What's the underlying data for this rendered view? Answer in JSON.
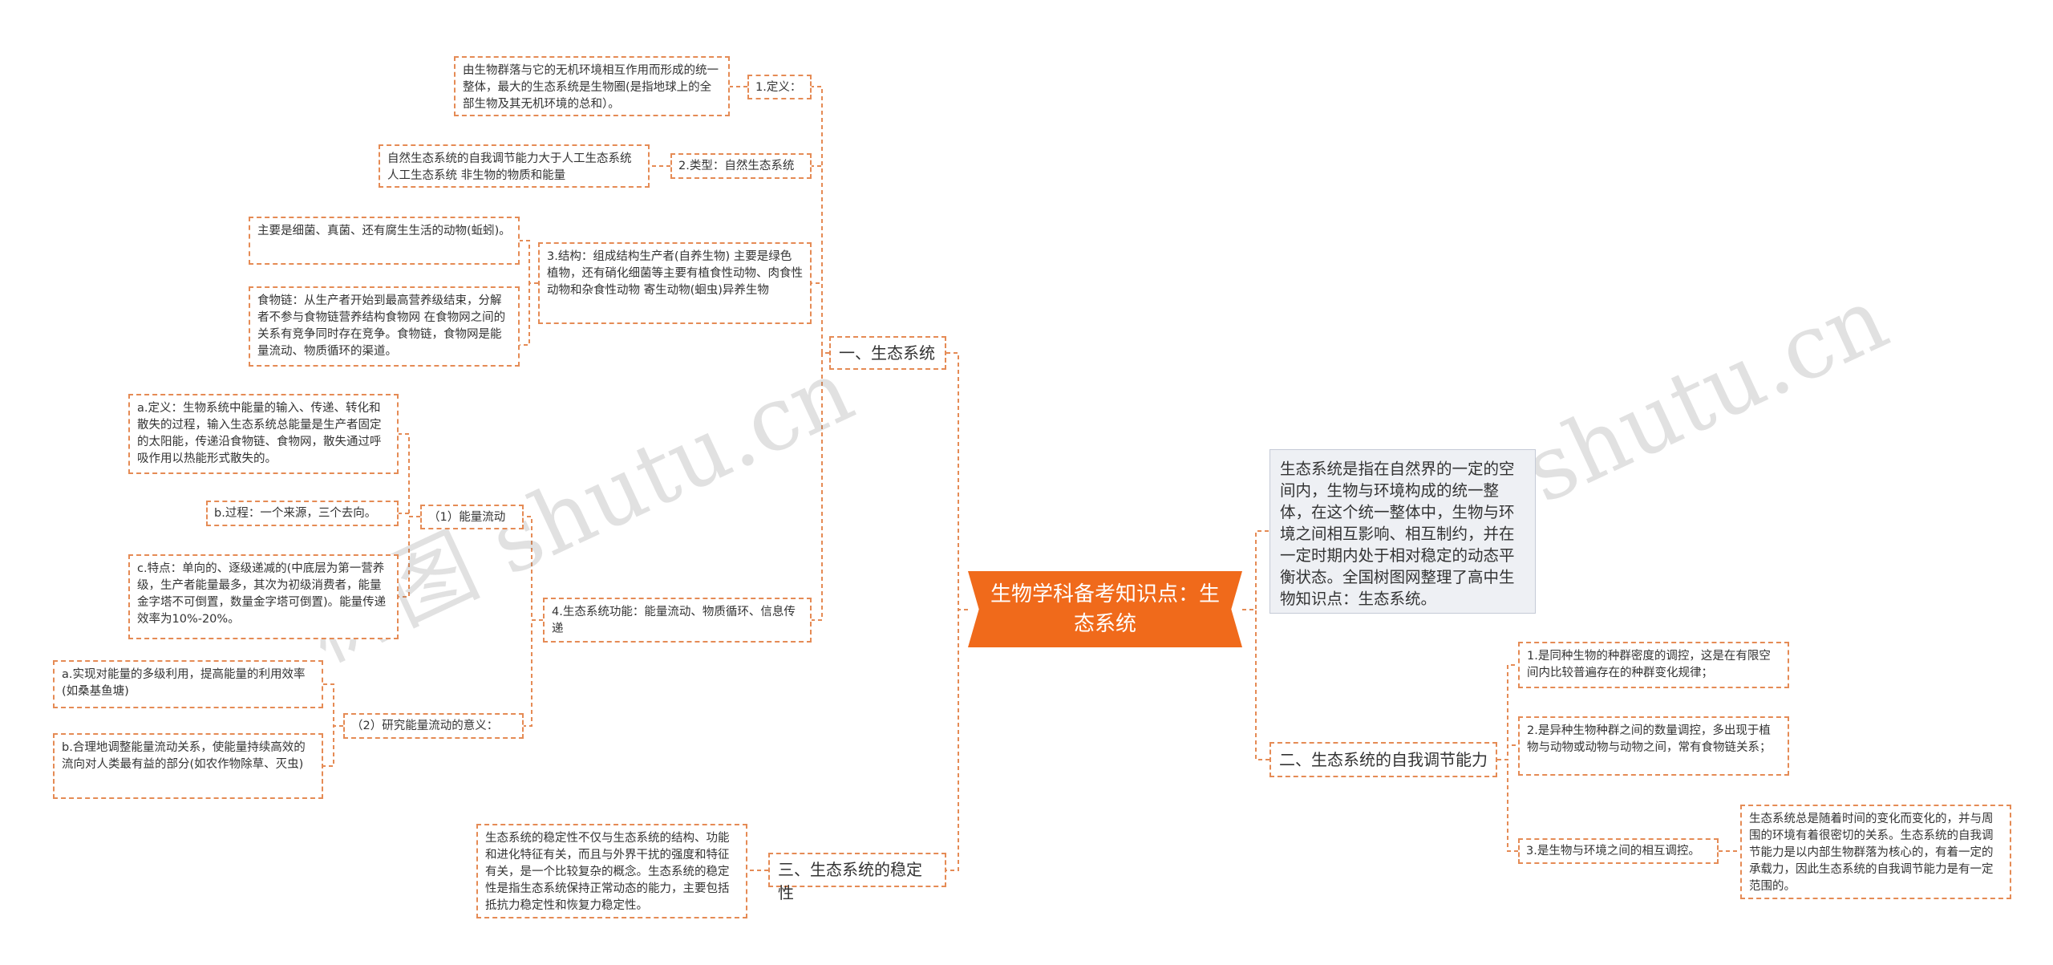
{
  "root": "生物学科备考知识点：生态系统",
  "summary": "生态系统是指在自然界的一定的空间内，生物与环境构成的统一整体，在这个统一整体中，生物与环境之间相互影响、相互制约，并在一定时期内处于相对稳定的动态平衡状态。全国树图网整理了高中生物知识点：生态系统。",
  "watermarks": [
    "树图 shutu.cn",
    "树图 shutu.cn"
  ],
  "left": {
    "b1": {
      "label": "一、生态系统",
      "def_label": "1.定义：",
      "def_text": "由生物群落与它的无机环境相互作用而形成的统一整体，最大的生态系统是生物圈(是指地球上的全部生物及其无机环境的总和）。",
      "type_label": "2.类型：自然生态系统",
      "type_text": "自然生态系统的自我调节能力大于人工生态系统 人工生态系统 非生物的物质和能量",
      "struct_label": "3.结构：组成结构生产者(自养生物) 主要是绿色植物，还有硝化细菌等主要有植食性动物、肉食性动物和杂食性动物 寄生动物(蛔虫)异养生物",
      "struct_a": "主要是细菌、真菌、还有腐生生活的动物(蚯蚓)。",
      "struct_b": "食物链：从生产者开始到最高营养级结束，分解者不参与食物链营养结构食物网 在食物网之间的关系有竞争同时存在竞争。食物链，食物网是能量流动、物质循环的渠道。",
      "func_label": "4.生态系统功能：能量流动、物质循环、信息传递",
      "flow_label": "（1）能量流动",
      "flow_a": "a.定义：生物系统中能量的输入、传递、转化和散失的过程，输入生态系统总能量是生产者固定的太阳能，传递沿食物链、食物网，散失通过呼吸作用以热能形式散失的。",
      "flow_b": "b.过程：一个来源，三个去向。",
      "flow_c": "c.特点：单向的、逐级递减的(中底层为第一营养级，生产者能量最多，其次为初级消费者，能量金字塔不可倒置，数量金字塔可倒置)。能量传递效率为10%-20%。",
      "sig_label": "（2）研究能量流动的意义：",
      "sig_a": "a.实现对能量的多级利用，提高能量的利用效率(如桑基鱼塘)",
      "sig_b": "b.合理地调整能量流动关系，使能量持续高效的流向对人类最有益的部分(如农作物除草、灭虫)"
    },
    "b3": {
      "label": "三、生态系统的稳定性",
      "text": "生态系统的稳定性不仅与生态系统的结构、功能和进化特征有关，而且与外界干扰的强度和特征有关，是一个比较复杂的概念。生态系统的稳定性是指生态系统保持正常动态的能力，主要包括抵抗力稳定性和恢复力稳定性。"
    }
  },
  "right": {
    "b2": {
      "label": "二、生态系统的自我调节能力",
      "i1": "1.是同种生物的种群密度的调控，这是在有限空间内比较普遍存在的种群变化规律；",
      "i2": "2.是异种生物种群之间的数量调控，多出现于植物与动物或动物与动物之间，常有食物链关系；",
      "i3": "3.是生物与环境之间的相互调控。",
      "i3_text": "生态系统总是随着时间的变化而变化的，并与周围的环境有着很密切的关系。生态系统的自我调节能力是以内部生物群落为核心的，有着一定的承载力，因此生态系统的自我调节能力是有一定范围的。"
    }
  },
  "colors": {
    "accent": "#f06a1b",
    "border": "#e58b55",
    "summary_bg": "#eef0f4"
  }
}
